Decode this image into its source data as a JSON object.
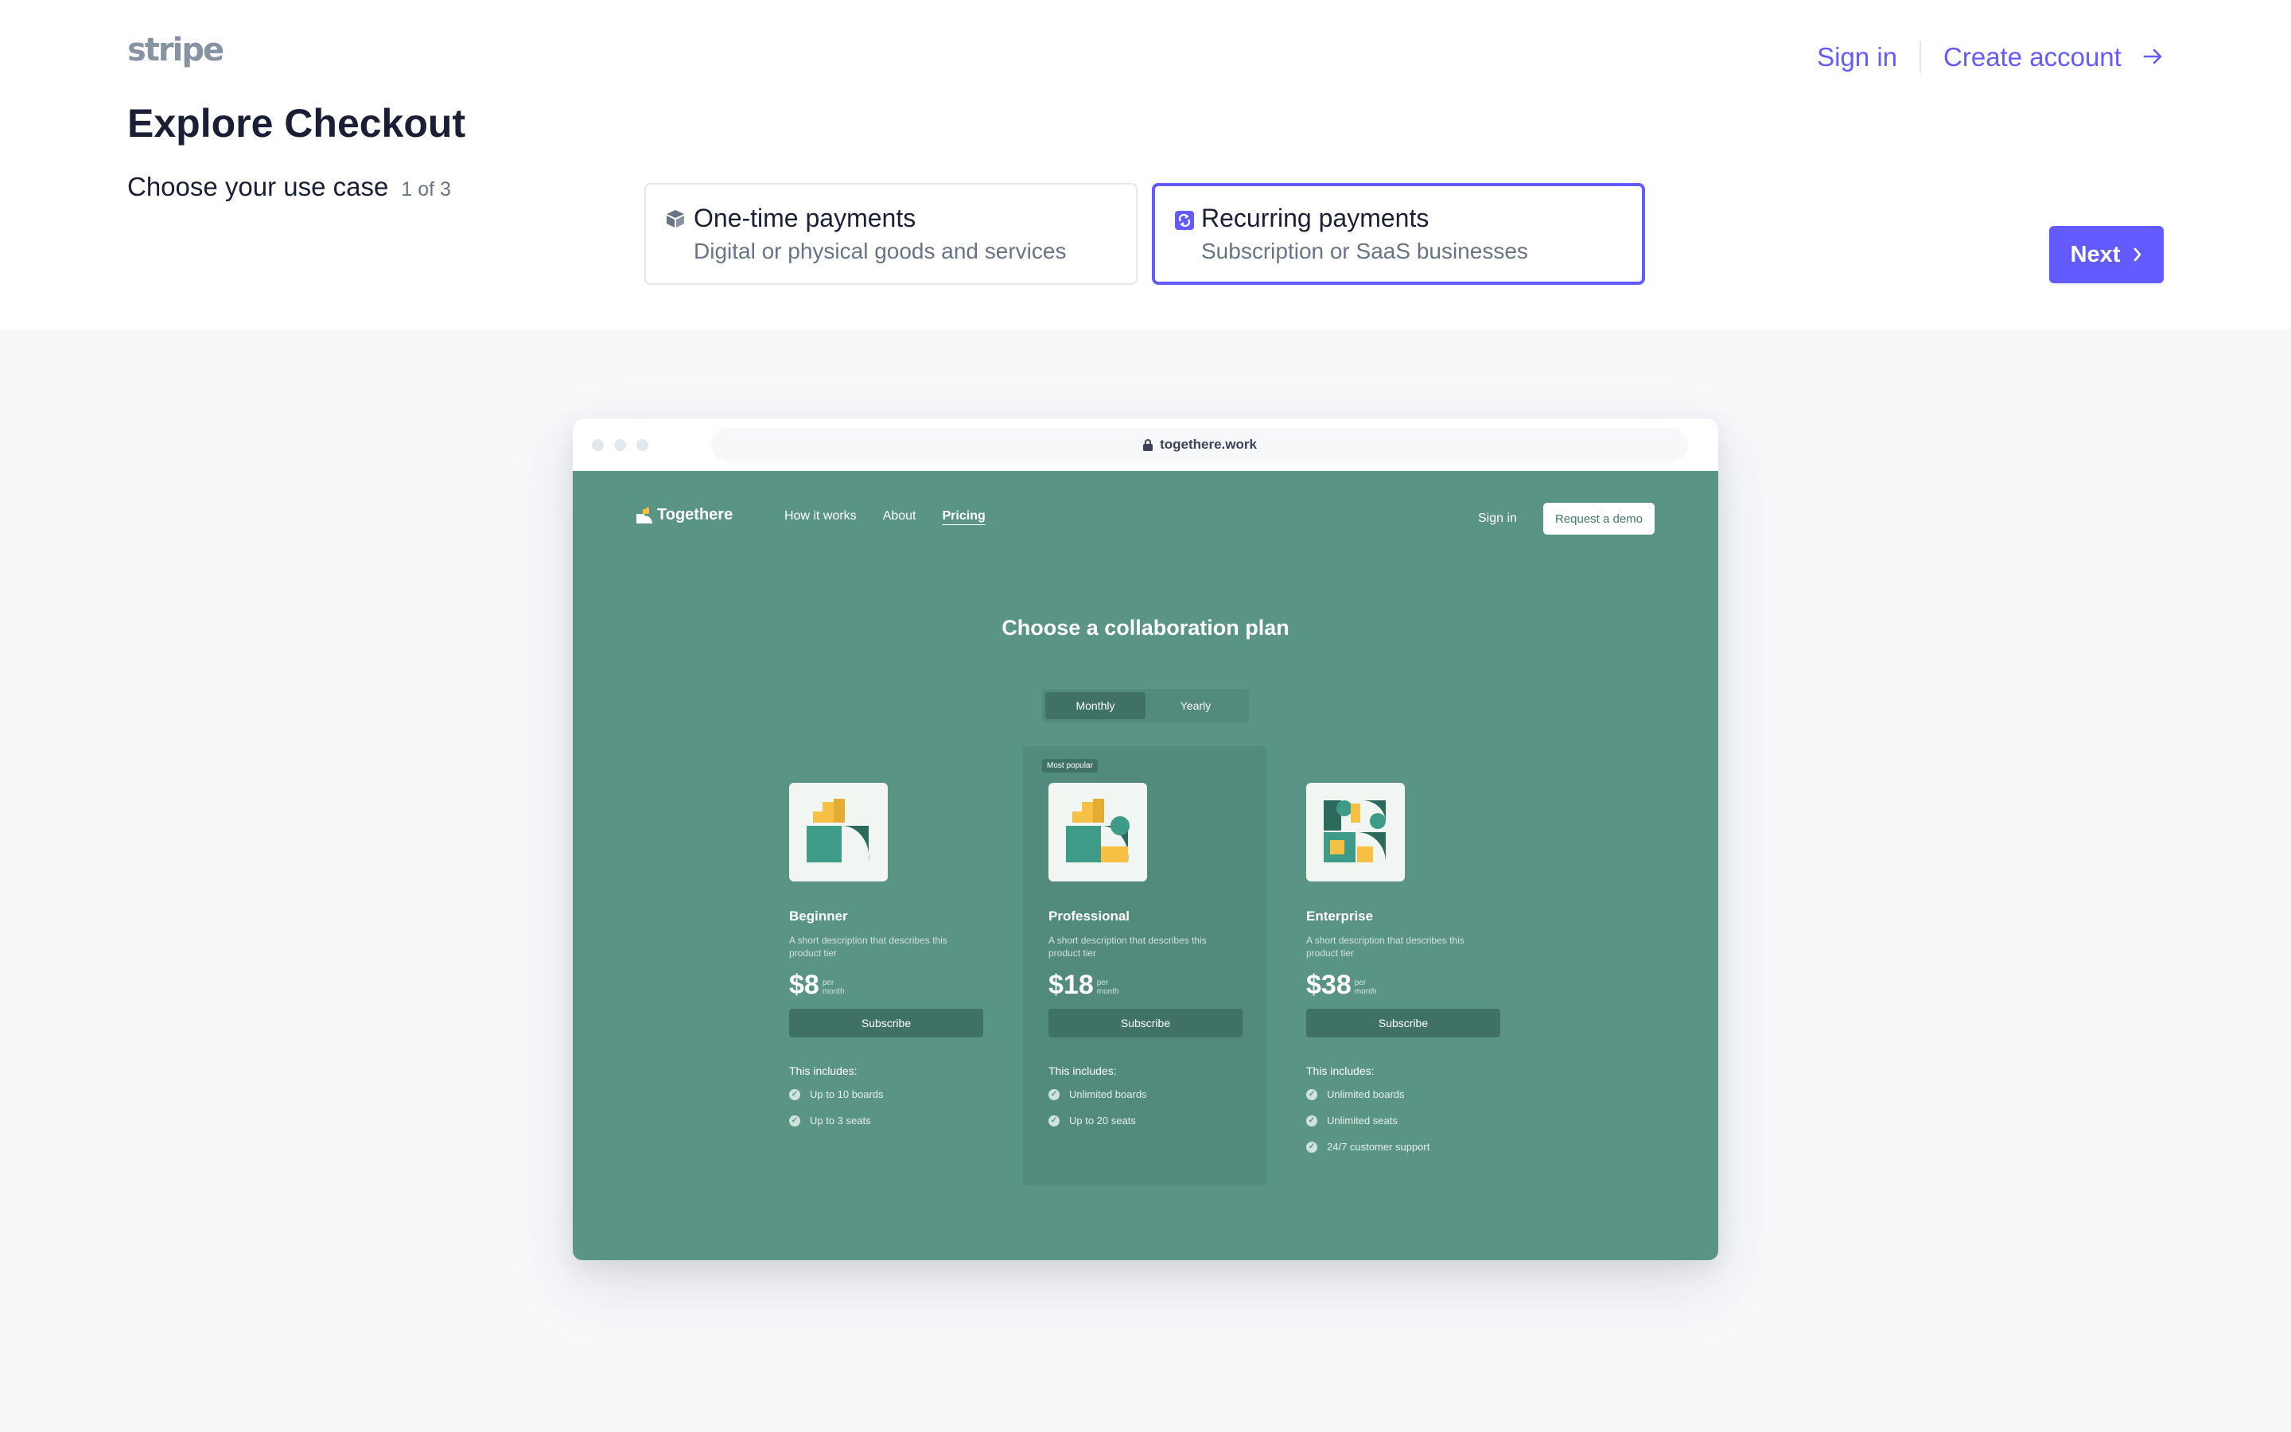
{
  "brand": {
    "logo": "stripe",
    "accent": "#635bff"
  },
  "header": {
    "title": "Explore Checkout",
    "sign_in": "Sign in",
    "create_account": "Create account"
  },
  "use_case": {
    "label": "Choose your use case",
    "step": "1 of 3",
    "options": [
      {
        "title": "One-time payments",
        "subtitle": "Digital or physical goods and services",
        "icon": "box-icon",
        "selected": false
      },
      {
        "title": "Recurring payments",
        "subtitle": "Subscription or SaaS businesses",
        "icon": "recurring-icon",
        "selected": true
      }
    ],
    "next": "Next"
  },
  "browser": {
    "url": "togethere.work",
    "site": {
      "logo": "Togethere",
      "nav": [
        "How it works",
        "About",
        "Pricing"
      ],
      "active_nav": "Pricing",
      "sign_in": "Sign in",
      "demo": "Request a demo",
      "heading": "Choose a collaboration plan",
      "billing": [
        "Monthly",
        "Yearly"
      ],
      "billing_selected": "Monthly",
      "badge": "Most popular",
      "includes_label": "This includes:",
      "subscribe": "Subscribe",
      "plans": [
        {
          "name": "Beginner",
          "desc": "A short description that describes this product tier",
          "price": "$8",
          "per": "per",
          "unit": "month",
          "features": [
            "Up to 10 boards",
            "Up to 3 seats"
          ]
        },
        {
          "name": "Professional",
          "desc": "A short description that describes this product tier",
          "price": "$18",
          "per": "per",
          "unit": "month",
          "features": [
            "Unlimited boards",
            "Up to 20 seats"
          ]
        },
        {
          "name": "Enterprise",
          "desc": "A short description that describes this product tier",
          "price": "$38",
          "per": "per",
          "unit": "month",
          "features": [
            "Unlimited boards",
            "Unlimited seats",
            "24/7 customer support"
          ]
        }
      ]
    }
  }
}
